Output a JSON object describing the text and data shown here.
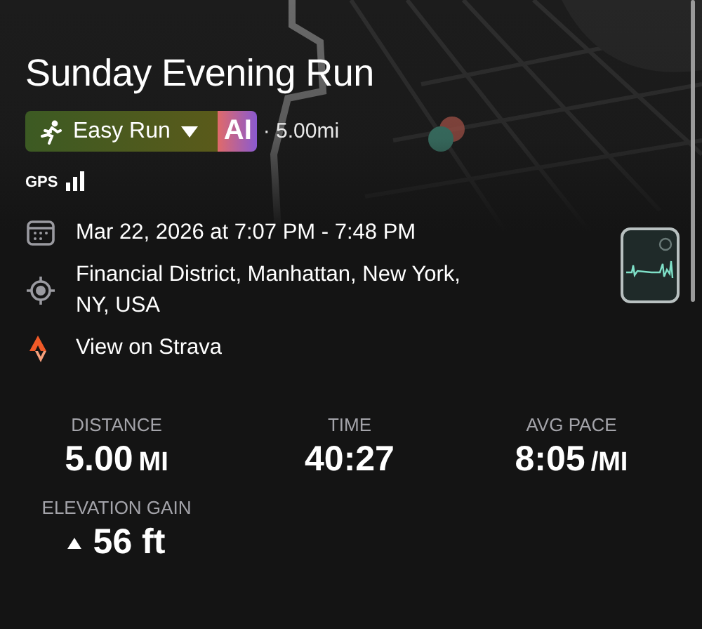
{
  "title": "Sunday Evening Run",
  "workout_type": {
    "label": "Easy Run",
    "ai_badge": "AI",
    "distance": "· 5.00mi"
  },
  "gps": {
    "label": "GPS"
  },
  "details": [
    {
      "kind": "date",
      "text": "Mar 22, 2026 at 7:07 PM - 7:48 PM"
    },
    {
      "kind": "location",
      "text": "Financial District, Manhattan, New York, NY, USA"
    },
    {
      "kind": "strava",
      "text": "View on Strava"
    }
  ],
  "stats": [
    {
      "kind": "plain",
      "label": "DISTANCE",
      "value": "5.00",
      "unit": "MI"
    },
    {
      "kind": "plain",
      "label": "TIME",
      "value": "40:27"
    },
    {
      "kind": "plain",
      "label": "AVG PACE",
      "value": "8:05",
      "unit": "/MI"
    },
    {
      "kind": "elevation",
      "label": "ELEVATION GAIN",
      "value": "56 ft"
    }
  ]
}
